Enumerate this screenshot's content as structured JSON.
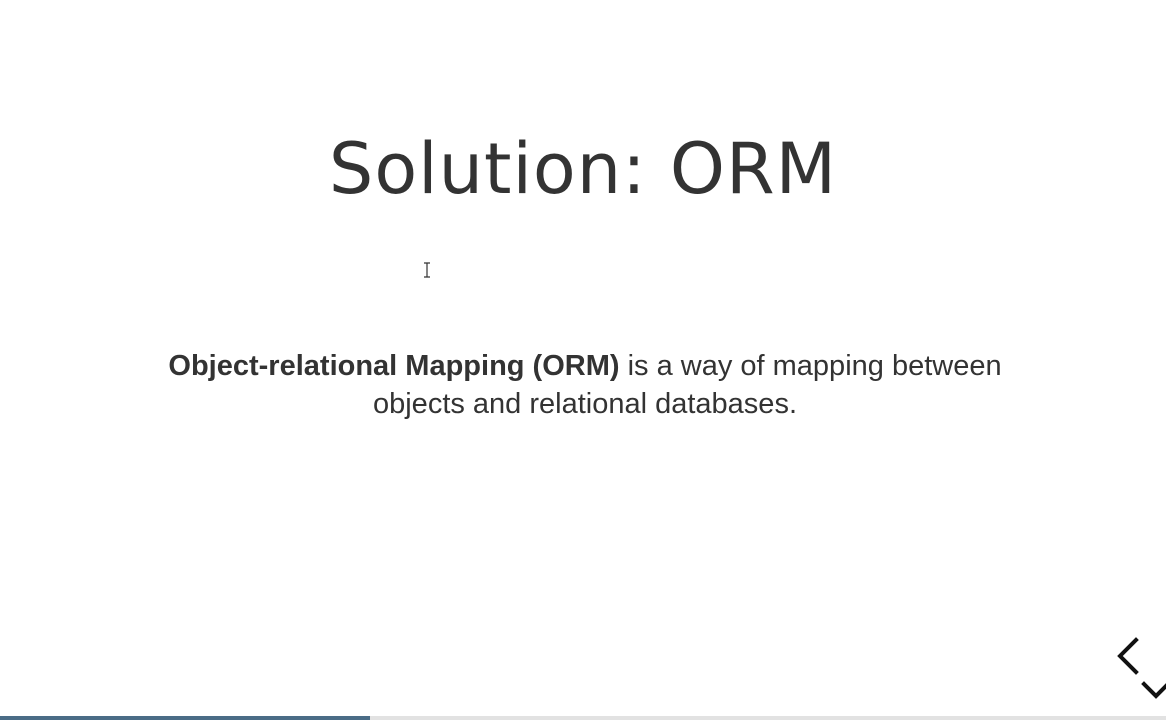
{
  "slide": {
    "title": "Solution: ORM",
    "body_term": "Object-relational Mapping (ORM)",
    "body_rest": " is a way of mapping between objects and relational databases."
  },
  "navigation": {
    "icons": [
      "chevron-left-icon",
      "chevron-down-icon"
    ],
    "arrow_color": "#111111"
  },
  "progress": {
    "fraction": 0.317,
    "fill_color": "#4a6c86",
    "track_color": "#e2e2e2"
  }
}
